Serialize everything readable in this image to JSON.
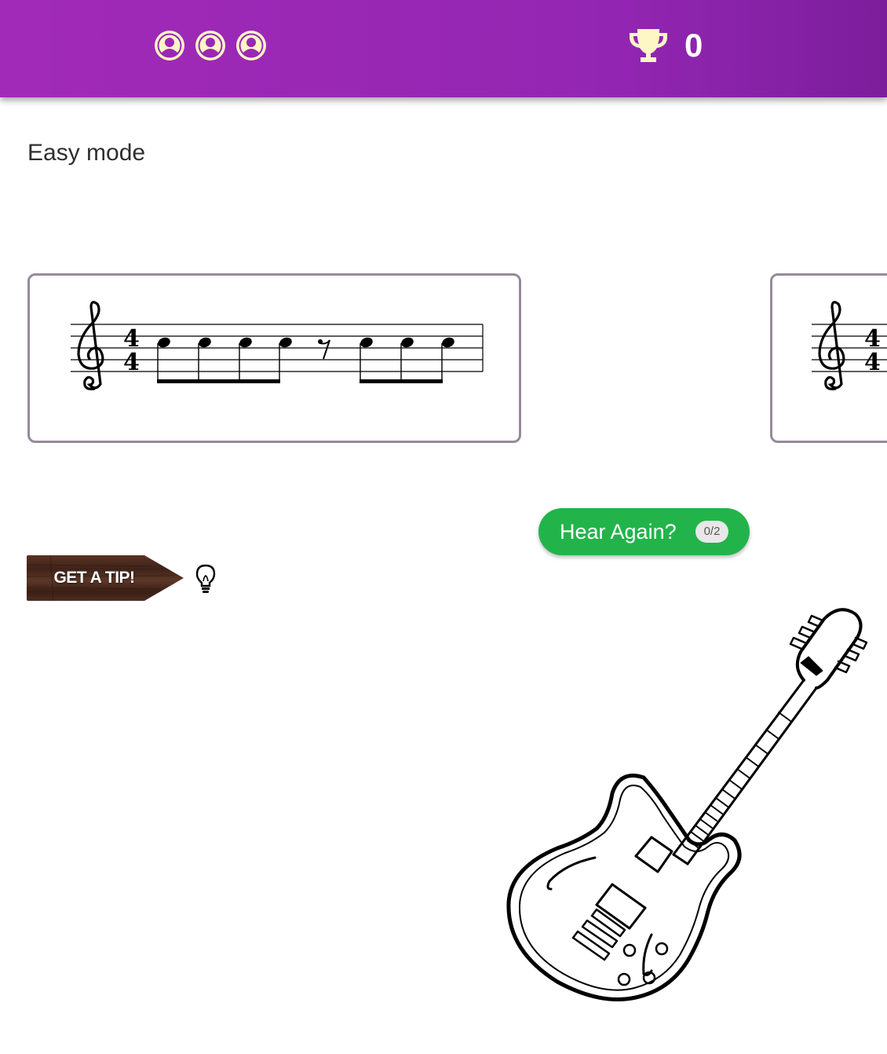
{
  "header": {
    "lives": [
      {
        "icon": "user-circle-icon"
      },
      {
        "icon": "user-circle-icon"
      },
      {
        "icon": "user-circle-icon"
      }
    ],
    "trophy_icon": "trophy-icon",
    "score": "0"
  },
  "mode_label": "Easy mode",
  "options": [
    {
      "clef": "treble",
      "time_signature": "4/4",
      "rhythm": [
        "eighth",
        "eighth",
        "eighth",
        "eighth",
        "eighth-rest",
        "eighth",
        "eighth",
        "eighth"
      ]
    },
    {
      "clef": "treble",
      "time_signature": "4/4"
    }
  ],
  "hear_again": {
    "label": "Hear Again?",
    "count": "0/2"
  },
  "tip": {
    "label": "GET A TIP!",
    "icon": "lightbulb-icon"
  },
  "illustration": {
    "icon": "guitar-icon"
  },
  "colors": {
    "header": "#9a27b5",
    "life_icon": "#fdf6c5",
    "hear_button": "#22b44a",
    "card_border": "#958a9a",
    "tip_wood": "#4a2a1e"
  }
}
